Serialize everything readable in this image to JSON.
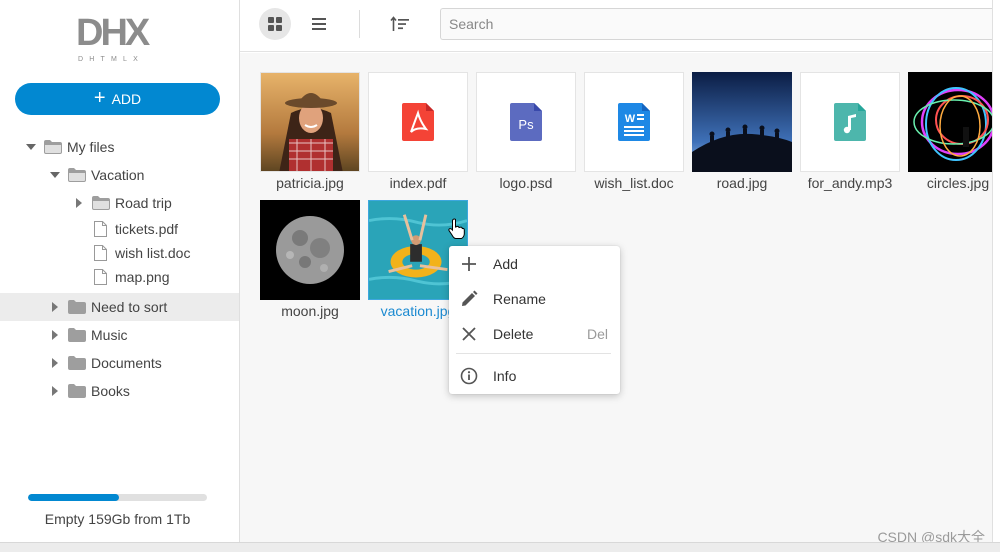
{
  "sidebar": {
    "logo_text": "DHX",
    "logo_subtext": "DHTMLX",
    "add_label": "ADD",
    "tree": [
      {
        "label": "My files",
        "type": "folder",
        "expanded": true
      },
      {
        "label": "Vacation",
        "type": "folder",
        "expanded": true
      },
      {
        "label": "Road trip",
        "type": "folder",
        "expanded": false
      },
      {
        "label": "tickets.pdf",
        "type": "file"
      },
      {
        "label": "wish list.doc",
        "type": "file"
      },
      {
        "label": "map.png",
        "type": "file"
      },
      {
        "label": "Need to sort",
        "type": "folder",
        "expanded": false,
        "selected": true
      },
      {
        "label": "Music",
        "type": "folder",
        "expanded": false
      },
      {
        "label": "Documents",
        "type": "folder",
        "expanded": false
      },
      {
        "label": "Books",
        "type": "folder",
        "expanded": false
      }
    ],
    "storage": {
      "used_fraction": 0.51,
      "text": "Empty 159Gb from 1Tb"
    }
  },
  "toolbar": {
    "search_placeholder": "Search",
    "view_grid_icon": "grid-view-icon",
    "view_list_icon": "list-view-icon",
    "sort_icon": "sort-icon"
  },
  "files": [
    {
      "name": "patricia.jpg",
      "kind": "photo-portrait"
    },
    {
      "name": "index.pdf",
      "kind": "pdf",
      "color": "#f44336"
    },
    {
      "name": "logo.psd",
      "kind": "psd",
      "color": "#5c6bc0"
    },
    {
      "name": "wish_list.doc",
      "kind": "doc",
      "color": "#1e88e5"
    },
    {
      "name": "road.jpg",
      "kind": "photo-road"
    },
    {
      "name": "for_andy.mp3",
      "kind": "audio",
      "color": "#4db6ac"
    },
    {
      "name": "circles.jpg",
      "kind": "photo-circles"
    },
    {
      "name": "moon.jpg",
      "kind": "photo-moon"
    },
    {
      "name": "vacation.jpg",
      "kind": "photo-vacation",
      "selected": true
    }
  ],
  "context_menu": {
    "items": [
      {
        "label": "Add",
        "icon": "plus-icon",
        "hotkey": ""
      },
      {
        "label": "Rename",
        "icon": "pencil-icon",
        "hotkey": ""
      },
      {
        "label": "Delete",
        "icon": "close-icon",
        "hotkey": "Del"
      },
      {
        "label": "Info",
        "icon": "info-icon",
        "hotkey": ""
      }
    ]
  },
  "watermark": "CSDN @sdk大全",
  "colors": {
    "accent": "#0288d1",
    "selection": "#ececec"
  }
}
